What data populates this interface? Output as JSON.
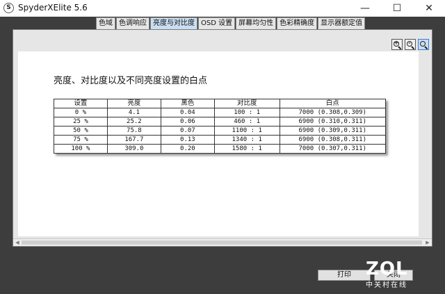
{
  "window": {
    "title": "SpyderXElite 5.6",
    "icon_letter": "S",
    "minimize": "—",
    "maximize": "☐",
    "close": "✕"
  },
  "tabs": [
    {
      "label": "色域"
    },
    {
      "label": "色调响应"
    },
    {
      "label": "亮度与对比度",
      "active": true
    },
    {
      "label": "OSD 设置"
    },
    {
      "label": "屏幕均匀性"
    },
    {
      "label": "色彩精确度"
    },
    {
      "label": "显示器额定值"
    }
  ],
  "zoom_icons": [
    "zoom-in-icon",
    "zoom-out-icon",
    "zoom-fit-icon"
  ],
  "report": {
    "title": "亮度、对比度以及不同亮度设置的白点",
    "columns": [
      "设置",
      "亮度",
      "黑色",
      "对比度",
      "白点"
    ],
    "rows": [
      [
        "0 %",
        "4.1",
        "0.04",
        "100 : 1",
        "7000 (0.308,0.309)"
      ],
      [
        "25 %",
        "25.2",
        "0.06",
        "460 : 1",
        "6900 (0.310,0.311)"
      ],
      [
        "50 %",
        "75.8",
        "0.07",
        "1100 : 1",
        "6900 (0.309,0.311)"
      ],
      [
        "75 %",
        "167.7",
        "0.13",
        "1340 : 1",
        "6900 (0.308,0.311)"
      ],
      [
        "100 %",
        "309.0",
        "0.20",
        "1580 : 1",
        "7000 (0.307,0.311)"
      ]
    ]
  },
  "scroll": {
    "left_arrow": "◀",
    "right_arrow": "▶"
  },
  "buttons": {
    "print": "打印",
    "apply": "关闭"
  },
  "watermark": {
    "logo": "ZOL",
    "subtitle": "中关村在线"
  },
  "colors": {
    "active_tab": "#c9def2",
    "background": "#3d3d3d"
  }
}
